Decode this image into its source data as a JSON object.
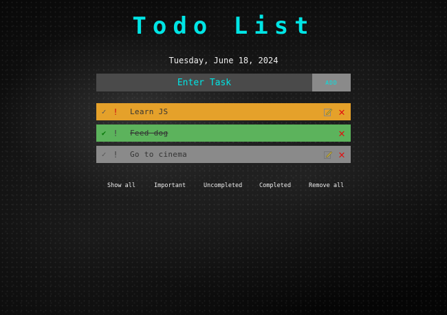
{
  "title": "Todo List",
  "date": "Tuesday, June 18, 2024",
  "input": {
    "placeholder": "Enter Task",
    "add_label": "ADD"
  },
  "tasks": [
    {
      "text": "Learn JS",
      "color": "#e5a12a",
      "completed": false,
      "important": true
    },
    {
      "text": "Feed dog",
      "color": "#5cb35c",
      "completed": true,
      "important": false
    },
    {
      "text": "Go to cinema",
      "color": "#8a8a8a",
      "completed": false,
      "important": false
    }
  ],
  "filters": {
    "show_all": "Show all",
    "important": "Important",
    "uncompleted": "Uncompleted",
    "completed": "Completed",
    "remove_all": "Remove all"
  },
  "icons": {
    "check": "check-icon",
    "important": "exclamation-icon",
    "edit": "edit-icon",
    "delete": "close-icon"
  },
  "colors": {
    "accent": "#00e5e5",
    "delete": "#e01010"
  }
}
